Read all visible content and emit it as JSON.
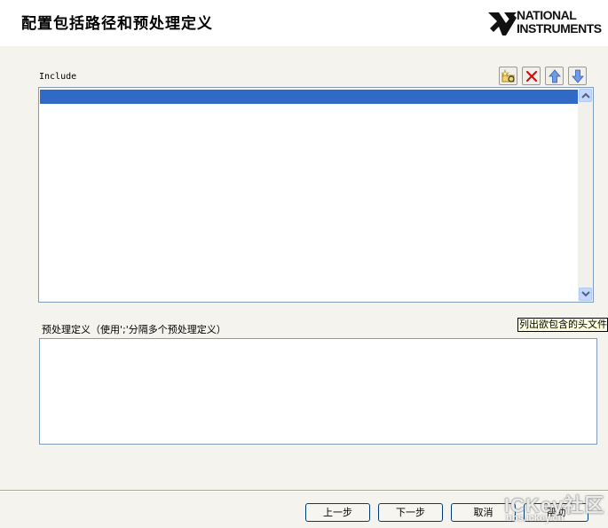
{
  "header": {
    "title": "配置包括路径和预处理定义",
    "logo_line1": "NATIONAL",
    "logo_line2": "INSTRUMENTS"
  },
  "include": {
    "label": "Include",
    "toolbar_icons": [
      "new-folder-icon",
      "delete-icon",
      "move-up-icon",
      "move-down-icon"
    ],
    "items": [
      ""
    ]
  },
  "defines": {
    "label": "预处理定义（使用';'分隔多个预处理定义）",
    "value": "",
    "tooltip": "列出欲包含的头文件"
  },
  "buttons": {
    "back": "上一步",
    "next": "下一步",
    "cancel": "取消",
    "help": "帮助"
  },
  "watermark": {
    "main": "ICKey社区",
    "sub": "bbs.ickey.cn"
  },
  "colors": {
    "selection": "#316ac5",
    "delete_red": "#d01010",
    "arrow_blue": "#4f7fd8",
    "button_border": "#003c74"
  }
}
